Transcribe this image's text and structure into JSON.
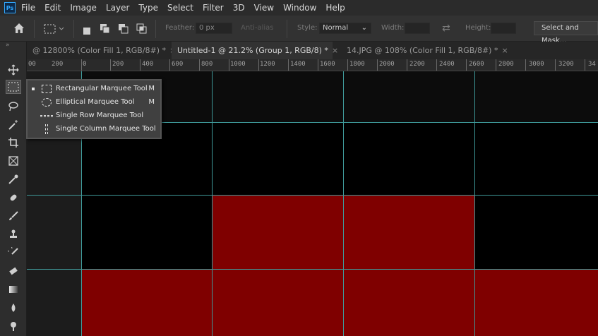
{
  "app": {
    "logo_text": "Ps"
  },
  "menu": [
    "File",
    "Edit",
    "Image",
    "Layer",
    "Type",
    "Select",
    "Filter",
    "3D",
    "View",
    "Window",
    "Help"
  ],
  "options_bar": {
    "feather_label": "Feather:",
    "feather_value": "0 px",
    "antialias_label": "Anti-alias",
    "style_label": "Style:",
    "style_value": "Normal",
    "width_label": "Width:",
    "height_label": "Height:",
    "select_mask_label": "Select and Mask..."
  },
  "tabs": [
    {
      "label": "@ 12800% (Color Fill 1, RGB/8#) *",
      "close": "×",
      "active": false
    },
    {
      "label": "Untitled-1 @ 21.2% (Group 1, RGB/8) *",
      "close": "×",
      "active": true
    },
    {
      "label": "14.JPG @ 108% (Color Fill 1, RGB/8#) *",
      "close": "×",
      "active": false
    }
  ],
  "ruler": {
    "labels": [
      "00",
      "200",
      "0",
      "200",
      "400",
      "600",
      "800",
      "1000",
      "1200",
      "1400",
      "1600",
      "1800",
      "2000",
      "2200",
      "2400",
      "2600",
      "2800",
      "3000",
      "3200",
      "34"
    ]
  },
  "flyout": {
    "items": [
      {
        "label": "Rectangular Marquee Tool",
        "key": "M",
        "icon": "rect-marquee-icon",
        "selected": true
      },
      {
        "label": "Elliptical Marquee Tool",
        "key": "M",
        "icon": "ellipse-marquee-icon",
        "selected": false
      },
      {
        "label": "Single Row Marquee Tool",
        "key": "",
        "icon": "single-row-marquee-icon",
        "selected": false
      },
      {
        "label": "Single Column Marquee Tool",
        "key": "",
        "icon": "single-column-marquee-icon",
        "selected": false
      }
    ]
  },
  "colors": {
    "canvas_black": "#000000",
    "canvas_red": "#7f0000",
    "guide": "#3f9a9a",
    "pasteboard": "#1c1c1c"
  }
}
